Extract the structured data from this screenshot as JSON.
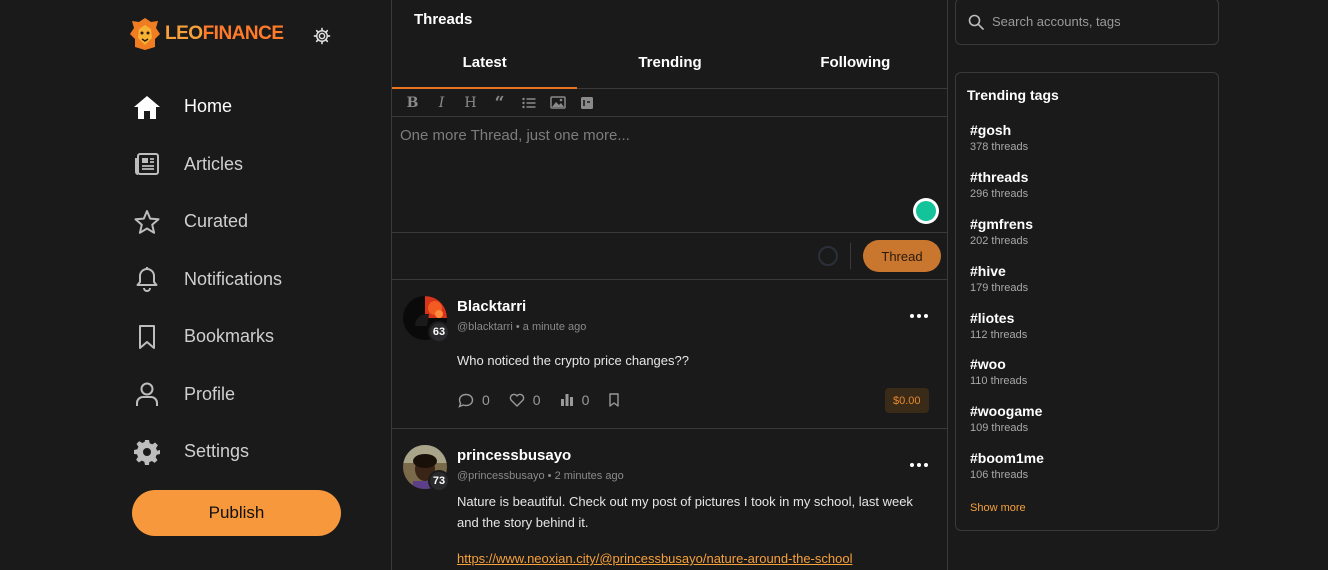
{
  "brand": {
    "logo_part1": "LEO",
    "logo_part2": "FINANCE"
  },
  "nav": {
    "items": [
      {
        "label": "Home",
        "icon": "home-icon"
      },
      {
        "label": "Articles",
        "icon": "newspaper-icon"
      },
      {
        "label": "Curated",
        "icon": "star-icon"
      },
      {
        "label": "Notifications",
        "icon": "bell-icon"
      },
      {
        "label": "Bookmarks",
        "icon": "bookmark-icon"
      },
      {
        "label": "Profile",
        "icon": "user-icon"
      },
      {
        "label": "Settings",
        "icon": "gear-icon"
      }
    ],
    "publish_label": "Publish"
  },
  "center": {
    "title": "Threads",
    "tabs": [
      {
        "label": "Latest"
      },
      {
        "label": "Trending"
      },
      {
        "label": "Following"
      }
    ],
    "composer": {
      "placeholder": "One more Thread, just one more...",
      "submit_label": "Thread"
    }
  },
  "posts": [
    {
      "author": "Blacktarri",
      "handle": "@blacktarri",
      "time": "a minute ago",
      "reputation": "63",
      "body": "Who noticed the crypto price changes??",
      "comments": "0",
      "likes": "0",
      "votes": "0",
      "payout": "$0.00"
    },
    {
      "author": "princessbusayo",
      "handle": "@princessbusayo",
      "time": "2 minutes ago",
      "reputation": "73",
      "body": "Nature is beautiful. Check out my post of pictures I took in my school, last week and the story behind it.",
      "link": "https://www.neoxian.city/@princessbusayo/nature-around-the-school"
    }
  ],
  "right": {
    "search_placeholder": "Search accounts, tags",
    "trending_title": "Trending tags",
    "tags": [
      {
        "name": "#gosh",
        "count": "378 threads"
      },
      {
        "name": "#threads",
        "count": "296 threads"
      },
      {
        "name": "#gmfrens",
        "count": "202 threads"
      },
      {
        "name": "#hive",
        "count": "179 threads"
      },
      {
        "name": "#liotes",
        "count": "112 threads"
      },
      {
        "name": "#woo",
        "count": "110 threads"
      },
      {
        "name": "#woogame",
        "count": "109 threads"
      },
      {
        "name": "#boom1me",
        "count": "106 threads"
      }
    ],
    "show_more": "Show more"
  },
  "colors": {
    "accent": "#f7983c",
    "link": "#f6a03a",
    "background": "#1a1a1b"
  }
}
